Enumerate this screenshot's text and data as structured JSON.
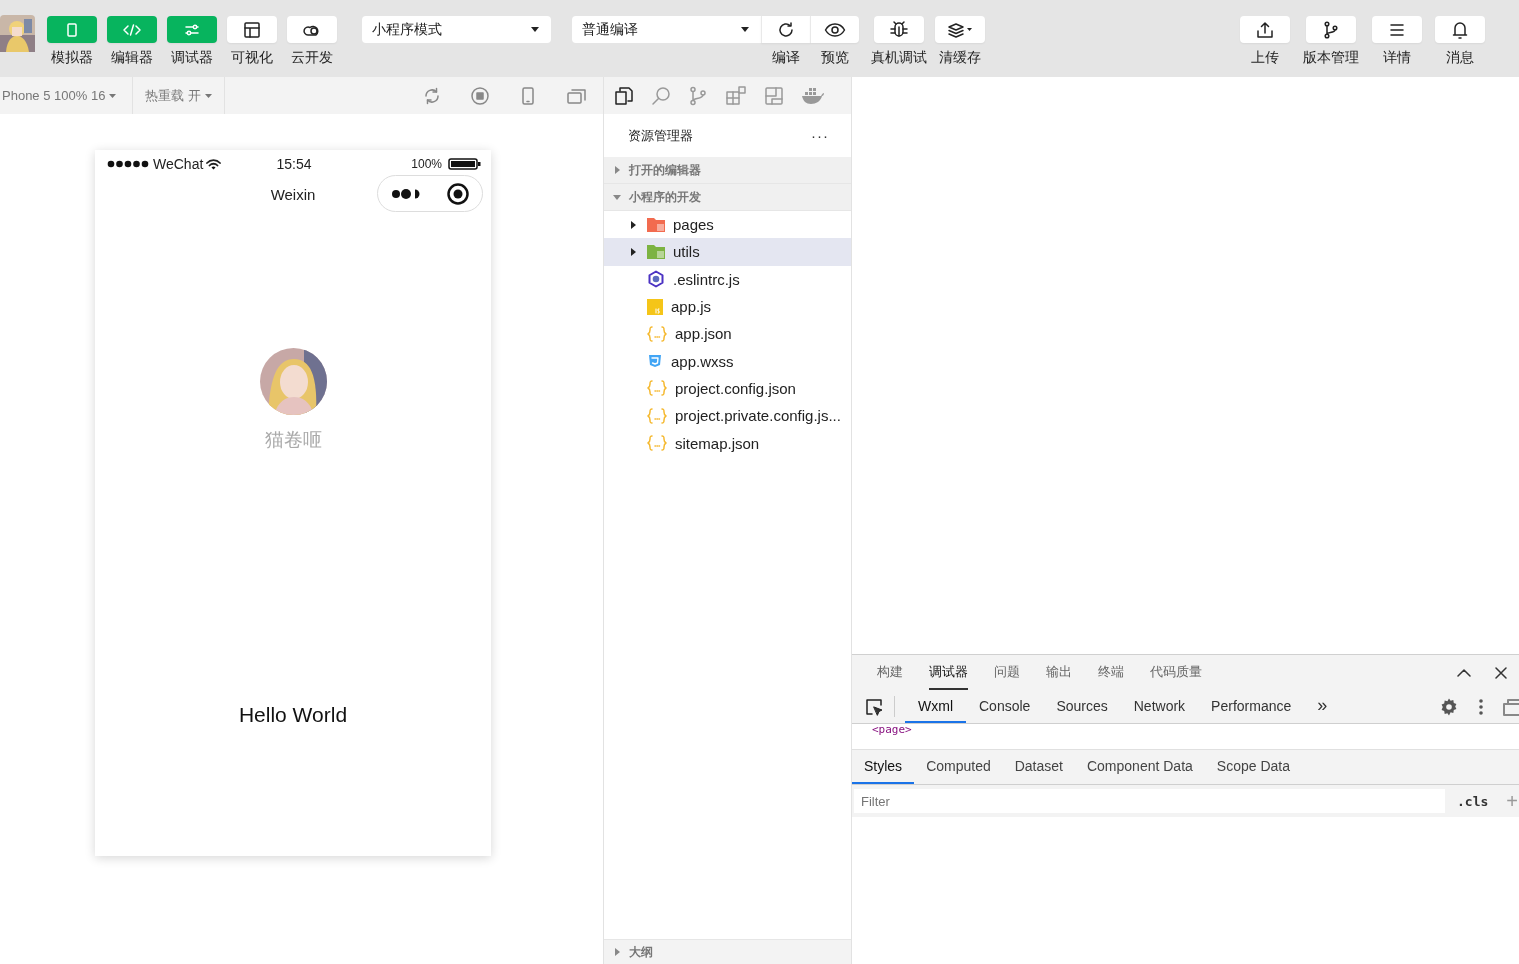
{
  "toolbar": {
    "left_buttons": [
      {
        "label": "模拟器",
        "kind": "phone",
        "on": true
      },
      {
        "label": "编辑器",
        "kind": "code",
        "on": true
      },
      {
        "label": "调试器",
        "kind": "sliders",
        "on": true
      },
      {
        "label": "可视化",
        "kind": "layout",
        "on": false
      },
      {
        "label": "云开发",
        "kind": "cloud",
        "on": false
      }
    ],
    "mode_select": "小程序模式",
    "compile_select": "普通编译",
    "compile_actions": [
      {
        "label": "编译",
        "kind": "refresh"
      },
      {
        "label": "预览",
        "kind": "eye"
      }
    ],
    "device_actions": [
      {
        "label": "真机调试",
        "kind": "bug"
      },
      {
        "label": "清缓存",
        "kind": "layers"
      }
    ],
    "right_buttons": [
      {
        "label": "上传",
        "kind": "upload"
      },
      {
        "label": "版本管理",
        "kind": "branch"
      },
      {
        "label": "详情",
        "kind": "menu"
      },
      {
        "label": "消息",
        "kind": "bell"
      }
    ]
  },
  "simulator": {
    "device": "Phone 5 100% 16",
    "hot_reload": "热重载 开",
    "phone": {
      "carrier": "WeChat",
      "time": "15:54",
      "battery": "100%",
      "nav_title": "Weixin",
      "nickname": "猫卷咂",
      "body_text": "Hello World"
    }
  },
  "explorer": {
    "title": "资源管理器",
    "more": "···",
    "sections": [
      {
        "label": "打开的编辑器",
        "expanded": false
      },
      {
        "label": "小程序的开发",
        "expanded": true
      }
    ],
    "files": [
      {
        "name": "pages",
        "kind": "folder",
        "color": "#f26b4f",
        "expanded": false,
        "selected": false
      },
      {
        "name": "utils",
        "kind": "folder",
        "color": "#7cb342",
        "expanded": false,
        "selected": true
      },
      {
        "name": ".eslintrc.js",
        "kind": "eslint",
        "selected": false
      },
      {
        "name": "app.js",
        "kind": "js",
        "selected": false
      },
      {
        "name": "app.json",
        "kind": "json",
        "selected": false
      },
      {
        "name": "app.wxss",
        "kind": "css",
        "selected": false
      },
      {
        "name": "project.config.json",
        "kind": "json",
        "selected": false
      },
      {
        "name": "project.private.config.js...",
        "kind": "json",
        "selected": false
      },
      {
        "name": "sitemap.json",
        "kind": "json",
        "selected": false
      }
    ],
    "outline": "大纲"
  },
  "devtools": {
    "tabs": [
      {
        "label": "构建",
        "selected": false
      },
      {
        "label": "调试器",
        "selected": true
      },
      {
        "label": "问题",
        "selected": false
      },
      {
        "label": "输出",
        "selected": false
      },
      {
        "label": "终端",
        "selected": false
      },
      {
        "label": "代码质量",
        "selected": false
      }
    ],
    "panel_tabs": [
      {
        "label": "Wxml",
        "selected": true
      },
      {
        "label": "Console",
        "selected": false
      },
      {
        "label": "Sources",
        "selected": false
      },
      {
        "label": "Network",
        "selected": false
      },
      {
        "label": "Performance",
        "selected": false
      }
    ],
    "more": "»",
    "code": "<page>",
    "style_tabs": [
      {
        "label": "Styles",
        "selected": true
      },
      {
        "label": "Computed",
        "selected": false
      },
      {
        "label": "Dataset",
        "selected": false
      },
      {
        "label": "Component Data",
        "selected": false
      },
      {
        "label": "Scope Data",
        "selected": false
      }
    ],
    "filter_placeholder": "Filter",
    "cls": ".cls",
    "add": "+"
  }
}
